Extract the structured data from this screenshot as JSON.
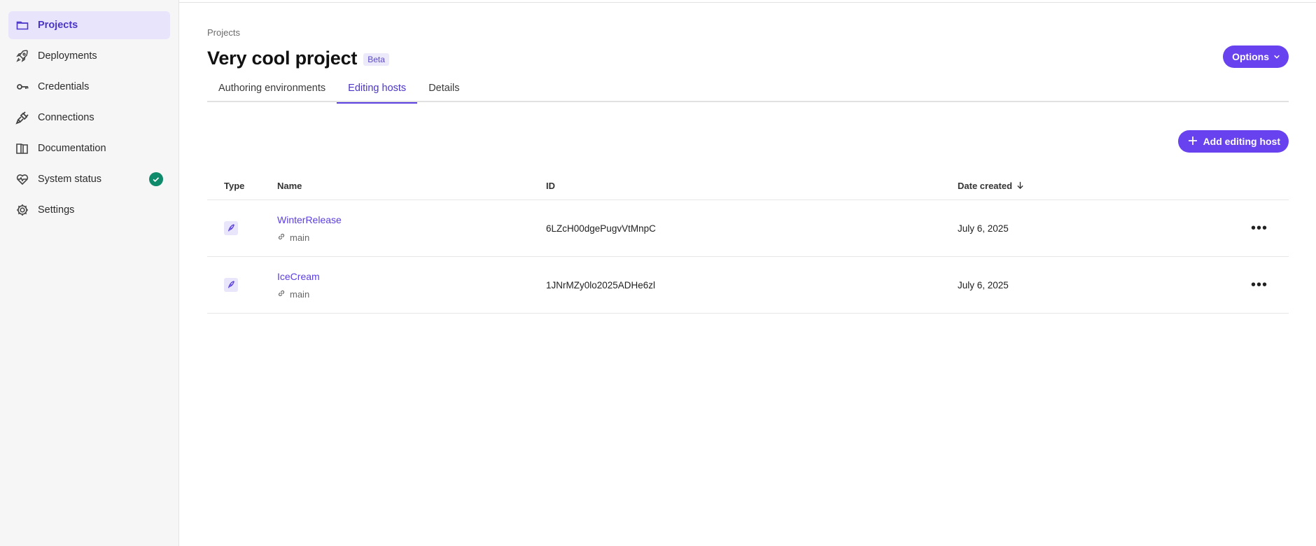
{
  "sidebar": {
    "items": [
      {
        "label": "Projects",
        "icon": "folder-icon",
        "active": true
      },
      {
        "label": "Deployments",
        "icon": "rocket-icon"
      },
      {
        "label": "Credentials",
        "icon": "key-icon"
      },
      {
        "label": "Connections",
        "icon": "plug-icon"
      },
      {
        "label": "Documentation",
        "icon": "book-icon"
      },
      {
        "label": "System status",
        "icon": "heartbeat-icon",
        "badge": "check-circle-icon"
      },
      {
        "label": "Settings",
        "icon": "gear-icon"
      }
    ]
  },
  "header": {
    "breadcrumb": "Projects",
    "title": "Very cool project",
    "badge": "Beta",
    "options_label": "Options"
  },
  "tabs": [
    {
      "label": "Authoring environments"
    },
    {
      "label": "Editing hosts",
      "active": true
    },
    {
      "label": "Details"
    }
  ],
  "toolbar": {
    "add_label": "Add editing host"
  },
  "table": {
    "columns": {
      "type": "Type",
      "name": "Name",
      "id": "ID",
      "date": "Date created"
    },
    "rows": [
      {
        "name": "WinterRelease",
        "branch": "main",
        "id": "6LZcH00dgePugvVtMnpC",
        "date": "July 6, 2025"
      },
      {
        "name": "IceCream",
        "branch": "main",
        "id": "1JNrMZy0lo2025ADHe6zl",
        "date": "July 6, 2025"
      }
    ]
  },
  "colors": {
    "accent": "#6842ef",
    "active_bg": "#e8e4fb",
    "status_ok": "#0f8a6a"
  }
}
